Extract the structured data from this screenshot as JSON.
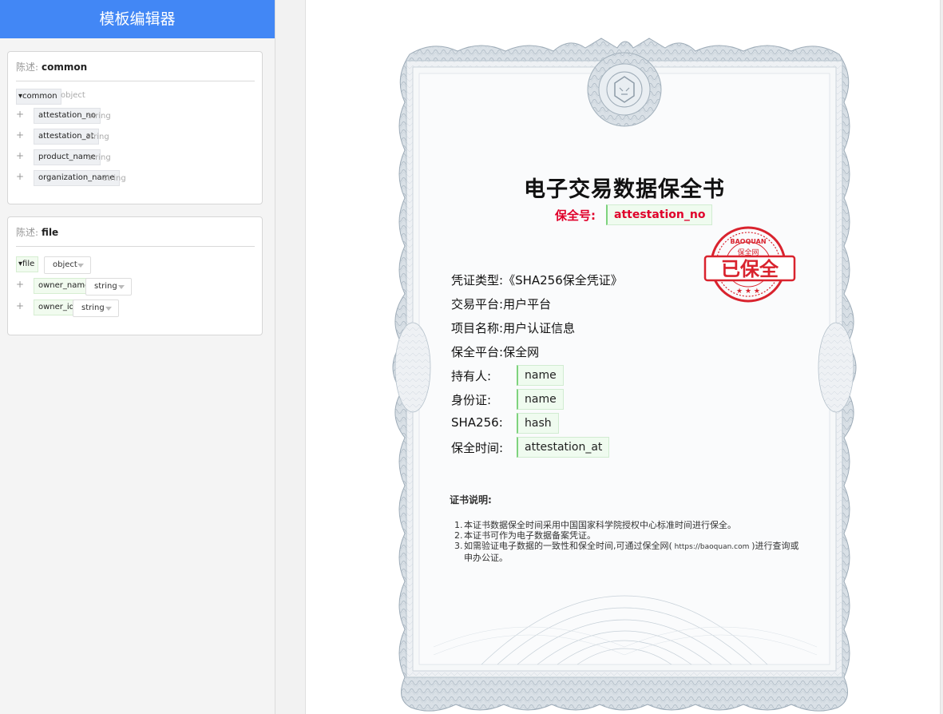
{
  "app": {
    "title": "模板编辑器"
  },
  "cards": {
    "common": {
      "desc_label": "陈述:",
      "desc_value": "common",
      "root": {
        "key": "▾common",
        "type": "object"
      },
      "fields": [
        {
          "key": "attestation_no",
          "type": "string"
        },
        {
          "key": "attestation_at",
          "type": "string"
        },
        {
          "key": "product_name",
          "type": "string"
        },
        {
          "key": "organization_name",
          "type": "string"
        }
      ]
    },
    "file": {
      "desc_label": "陈述:",
      "desc_value": "file",
      "root": {
        "key": "▾file",
        "type": "object"
      },
      "fields": [
        {
          "key": "owner_name",
          "type": "string"
        },
        {
          "key": "owner_id",
          "type": "string"
        }
      ]
    }
  },
  "plus_symbol": "+",
  "certificate": {
    "title": "电子交易数据保全书",
    "number_label": "保全号:",
    "number_value": "attestation_no",
    "seal_text": {
      "ring_top": "BAOQUAN",
      "ring_bottom": "保全网",
      "center": "已保全"
    },
    "lines": [
      {
        "label": "凭证类型:",
        "value": "《SHA256保全凭证》"
      },
      {
        "label": "交易平台:",
        "value": "用户平台"
      },
      {
        "label": "项目名称:",
        "value": "用户认证信息"
      },
      {
        "label": "保全平台:",
        "value": "保全网"
      }
    ],
    "field_lines": [
      {
        "label": "持有人:",
        "value": "name"
      },
      {
        "label": "身份证:",
        "value": "name"
      },
      {
        "label": "SHA256:",
        "value": "hash"
      },
      {
        "label": "保全时间:",
        "value": "attestation_at"
      }
    ],
    "notes_title": "证书说明:",
    "notes": [
      {
        "num": "1.",
        "text": "本证书数据保全时间采用中国国家科学院授权中心标准时间进行保全。"
      },
      {
        "num": "2.",
        "text": "本证书可作为电子数据备案凭证。"
      },
      {
        "num": "3.",
        "text_a": "如需验证电子数据的一致性和保全时间,可通过保全网(",
        "url": " https://baoquan.com ",
        "text_b": ")进行查询或申办公证。"
      }
    ]
  },
  "colors": {
    "header": "#4287f5",
    "seal": "#d9232e",
    "field_bg": "#effbef",
    "field_border": "#7ed37e"
  }
}
